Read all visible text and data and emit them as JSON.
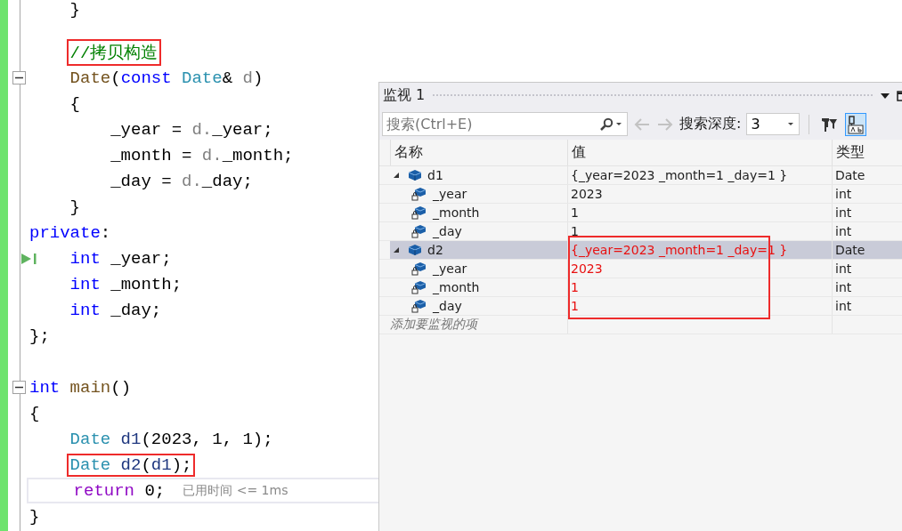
{
  "editor": {
    "lines": [
      {
        "collapsible": false,
        "boxed": false,
        "current": false,
        "run_to_click": false,
        "tokens": [
          {
            "text": "    }",
            "kind": "plain"
          }
        ]
      },
      {
        "blank_line_before": true,
        "collapsible": false,
        "boxed": true,
        "current": false,
        "run_to_click": false,
        "tokens": [
          {
            "text": "    //拷贝构造",
            "kind": "comment"
          }
        ]
      },
      {
        "collapsible": true,
        "boxed": false,
        "current": false,
        "run_to_click": false,
        "tokens": [
          {
            "text": "    Date",
            "kind": "function"
          },
          {
            "text": "(",
            "kind": "plain"
          },
          {
            "text": "const",
            "kind": "keyword"
          },
          {
            "text": " Date",
            "kind": "type"
          },
          {
            "text": "& ",
            "kind": "plain"
          },
          {
            "text": "d",
            "kind": "param"
          },
          {
            "text": ")",
            "kind": "plain"
          }
        ]
      },
      {
        "collapsible": false,
        "boxed": false,
        "current": false,
        "run_to_click": false,
        "tokens": [
          {
            "text": "    {",
            "kind": "plain"
          }
        ]
      },
      {
        "collapsible": false,
        "boxed": false,
        "current": false,
        "run_to_click": false,
        "tokens": [
          {
            "text": "        _year = ",
            "kind": "plain"
          },
          {
            "text": "d.",
            "kind": "param"
          },
          {
            "text": "_year;",
            "kind": "plain"
          }
        ]
      },
      {
        "collapsible": false,
        "boxed": false,
        "current": false,
        "run_to_click": false,
        "tokens": [
          {
            "text": "        _month = ",
            "kind": "plain"
          },
          {
            "text": "d.",
            "kind": "param"
          },
          {
            "text": "_month;",
            "kind": "plain"
          }
        ]
      },
      {
        "collapsible": false,
        "boxed": false,
        "current": false,
        "run_to_click": false,
        "tokens": [
          {
            "text": "        _day = ",
            "kind": "plain"
          },
          {
            "text": "d.",
            "kind": "param"
          },
          {
            "text": "_day;",
            "kind": "plain"
          }
        ]
      },
      {
        "collapsible": false,
        "boxed": false,
        "current": false,
        "run_to_click": false,
        "tokens": [
          {
            "text": "    }",
            "kind": "plain"
          }
        ]
      },
      {
        "collapsible": false,
        "boxed": false,
        "current": false,
        "run_to_click": false,
        "tokens": [
          {
            "text": "private",
            "kind": "keyword"
          },
          {
            "text": ":",
            "kind": "plain"
          }
        ]
      },
      {
        "collapsible": false,
        "boxed": false,
        "current": false,
        "run_to_click": true,
        "tokens": [
          {
            "text": "    int",
            "kind": "keyword"
          },
          {
            "text": " _year;",
            "kind": "plain"
          }
        ]
      },
      {
        "collapsible": false,
        "boxed": false,
        "current": false,
        "run_to_click": false,
        "tokens": [
          {
            "text": "    int",
            "kind": "keyword"
          },
          {
            "text": " _month;",
            "kind": "plain"
          }
        ]
      },
      {
        "collapsible": false,
        "boxed": false,
        "current": false,
        "run_to_click": false,
        "tokens": [
          {
            "text": "    int",
            "kind": "keyword"
          },
          {
            "text": " _day;",
            "kind": "plain"
          }
        ]
      },
      {
        "collapsible": false,
        "boxed": false,
        "current": false,
        "run_to_click": false,
        "tokens": [
          {
            "text": "};",
            "kind": "plain"
          }
        ]
      },
      {
        "blank_line_before": true,
        "collapsible": true,
        "boxed": false,
        "current": false,
        "run_to_click": false,
        "tokens": [
          {
            "text": "int",
            "kind": "keyword"
          },
          {
            "text": " main",
            "kind": "function"
          },
          {
            "text": "()",
            "kind": "plain"
          }
        ]
      },
      {
        "collapsible": false,
        "boxed": false,
        "current": false,
        "run_to_click": false,
        "tokens": [
          {
            "text": "{",
            "kind": "plain"
          }
        ]
      },
      {
        "collapsible": false,
        "boxed": false,
        "current": false,
        "run_to_click": false,
        "tokens": [
          {
            "text": "    Date",
            "kind": "type"
          },
          {
            "text": " d1",
            "kind": "variable"
          },
          {
            "text": "(2023, 1, 1);",
            "kind": "plain"
          }
        ]
      },
      {
        "collapsible": false,
        "boxed": true,
        "current": false,
        "run_to_click": false,
        "tokens": [
          {
            "text": "    Date",
            "kind": "type"
          },
          {
            "text": " d2",
            "kind": "variable"
          },
          {
            "text": "(",
            "kind": "plain"
          },
          {
            "text": "d1",
            "kind": "variable"
          },
          {
            "text": ");",
            "kind": "plain"
          }
        ]
      },
      {
        "collapsible": false,
        "boxed": false,
        "current": true,
        "run_to_click": false,
        "hint": "已用时间 <= 1ms",
        "tokens": [
          {
            "text": "    return",
            "kind": "control"
          },
          {
            "text": " 0;",
            "kind": "plain"
          }
        ]
      },
      {
        "collapsible": false,
        "boxed": false,
        "current": false,
        "run_to_click": false,
        "tokens": [
          {
            "text": "}",
            "kind": "plain"
          }
        ]
      }
    ]
  },
  "watch": {
    "title": "监视 1",
    "search": {
      "placeholder": "搜索(Ctrl+E)"
    },
    "nav_buttons": [
      {
        "kind": "back",
        "disabled": true
      },
      {
        "kind": "forward",
        "disabled": true
      }
    ],
    "depth_label": "搜索深度:",
    "depth_value": "3",
    "tool_buttons": [
      {
        "kind": "pin-filter",
        "selected": false
      },
      {
        "kind": "tab",
        "selected": true
      }
    ],
    "columns": [
      "名称",
      "值",
      "类型"
    ],
    "rows": [
      {
        "name": "d1",
        "value": "{_year=2023 _month=1 _day=1 }",
        "type": "Date",
        "kind": "object",
        "expanded": true,
        "selected": false,
        "changed": false,
        "boxed": false,
        "children": [
          {
            "name": "_year",
            "value": "2023",
            "type": "int",
            "kind": "member",
            "selected": false,
            "changed": false
          },
          {
            "name": "_month",
            "value": "1",
            "type": "int",
            "kind": "member",
            "selected": false,
            "changed": false
          },
          {
            "name": "_day",
            "value": "1",
            "type": "int",
            "kind": "member",
            "selected": false,
            "changed": false
          }
        ]
      },
      {
        "name": "d2",
        "value": "{_year=2023 _month=1 _day=1 }",
        "type": "Date",
        "kind": "object",
        "expanded": true,
        "selected": true,
        "changed": true,
        "boxed": true,
        "children": [
          {
            "name": "_year",
            "value": "2023",
            "type": "int",
            "kind": "member",
            "selected": false,
            "changed": true
          },
          {
            "name": "_month",
            "value": "1",
            "type": "int",
            "kind": "member",
            "selected": false,
            "changed": true
          },
          {
            "name": "_day",
            "value": "1",
            "type": "int",
            "kind": "member",
            "selected": false,
            "changed": true
          }
        ]
      }
    ],
    "add_placeholder": "添加要监视的项"
  }
}
